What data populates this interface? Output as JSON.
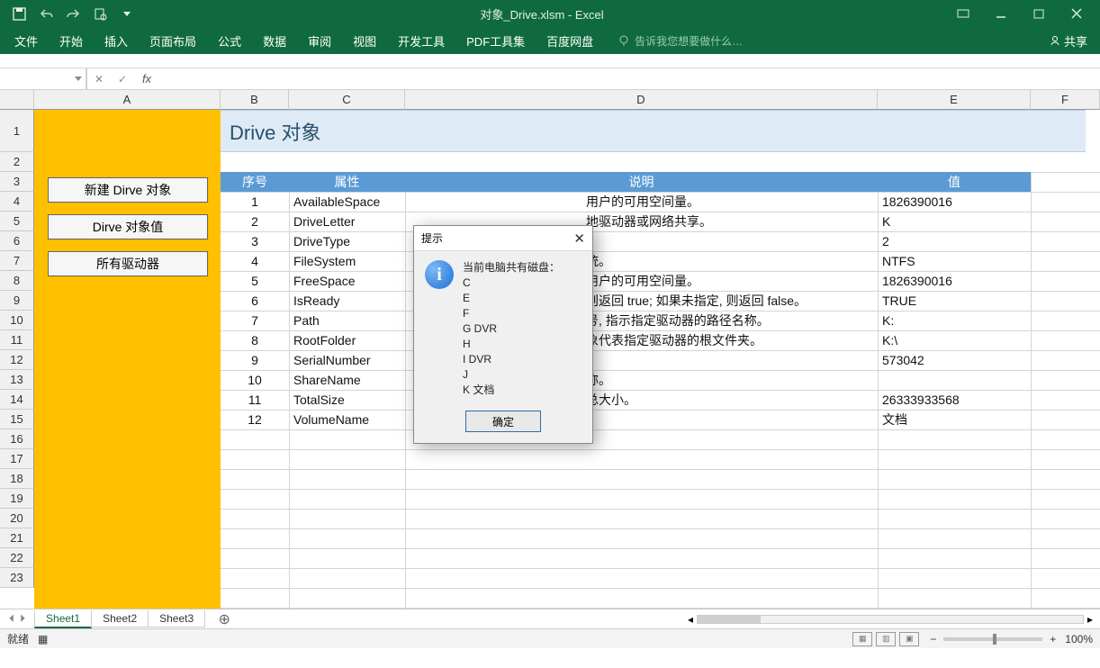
{
  "title": "对象_Drive.xlsm - Excel",
  "ribbon": {
    "tabs": [
      "文件",
      "开始",
      "插入",
      "页面布局",
      "公式",
      "数据",
      "审阅",
      "视图",
      "开发工具",
      "PDF工具集",
      "百度网盘"
    ],
    "tell": "告诉我您想要做什么…",
    "share": "共享"
  },
  "sheet": {
    "cols": [
      "A",
      "B",
      "C",
      "D",
      "E",
      "F"
    ],
    "merged_title": "Drive 对象",
    "header": {
      "a": "序号",
      "b": "属性",
      "c": "说明",
      "d": "值"
    },
    "buttons": {
      "b1": "新建 Dirve 对象",
      "b2": "Dirve 对象值",
      "b3": "所有驱动器"
    },
    "rows": [
      {
        "n": "1",
        "attr": "AvailableSpace",
        "desc": "用户的可用空间量。",
        "val": "1826390016"
      },
      {
        "n": "2",
        "attr": "DriveLetter",
        "desc": "地驱动器或网络共享。",
        "val": "K"
      },
      {
        "n": "3",
        "attr": "DriveType",
        "desc": "",
        "val": "2"
      },
      {
        "n": "4",
        "attr": "FileSystem",
        "desc": "统。",
        "val": "NTFS"
      },
      {
        "n": "5",
        "attr": "FreeSpace",
        "desc": "用户的可用空间量。",
        "val": "1826390016"
      },
      {
        "n": "6",
        "attr": "IsReady",
        "desc": "则返回 true; 如果未指定, 则返回 false。",
        "val": "TRUE"
      },
      {
        "n": "7",
        "attr": "Path",
        "desc": "号, 指示指定驱动器的路径名称。",
        "val": "K:"
      },
      {
        "n": "8",
        "attr": "RootFolder",
        "desc": "象代表指定驱动器的根文件夹。",
        "val": "K:\\"
      },
      {
        "n": "9",
        "attr": "SerialNumber",
        "desc": "",
        "val": "573042"
      },
      {
        "n": "10",
        "attr": "ShareName",
        "desc": "称。",
        "val": ""
      },
      {
        "n": "11",
        "attr": "TotalSize",
        "desc": "总大小。",
        "val": "26333933568"
      },
      {
        "n": "12",
        "attr": "VolumeName",
        "desc": "",
        "val": "文档"
      }
    ]
  },
  "dialog": {
    "title": "提示",
    "header": "当前电脑共有磁盘：",
    "lines": [
      "C",
      "E",
      "F",
      "G   DVR",
      "H",
      "I   DVR",
      "J",
      "K   文档"
    ],
    "ok": "确定"
  },
  "tabs": {
    "sheets": [
      "Sheet1",
      "Sheet2",
      "Sheet3"
    ],
    "active": 0
  },
  "status": {
    "ready": "就绪",
    "zoom": "100%"
  }
}
